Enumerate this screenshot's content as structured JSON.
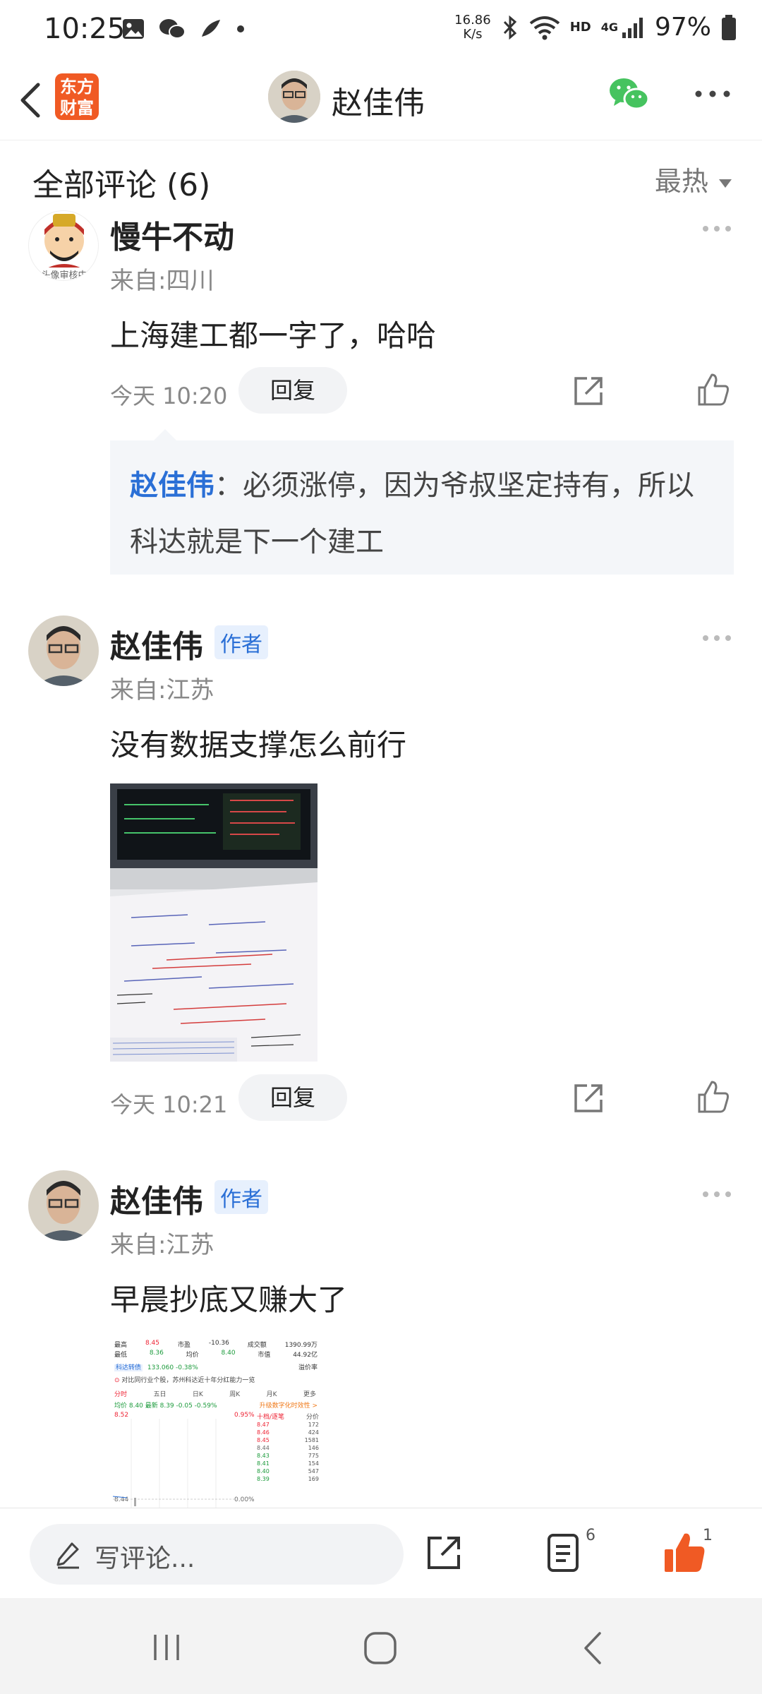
{
  "status_bar": {
    "time": "10:25",
    "speed_value": "16.86",
    "speed_unit": "K/s",
    "network": "4G",
    "hd_label": "HD",
    "battery": "97%"
  },
  "header": {
    "logo_line1": "东方",
    "logo_line2": "财富",
    "title": "赵佳伟"
  },
  "comments_header": {
    "title": "全部评论 (6)",
    "sort_label": "最热"
  },
  "comments": [
    {
      "username": "慢牛不动",
      "avatar_caption": "头像审核中",
      "location": "来自:四川",
      "text": "上海建工都一字了，哈哈",
      "time": "今天 10:20",
      "reply_label": "回复",
      "quoted_reply": {
        "name": "赵佳伟",
        "text": "：必须涨停，因为爷叔坚定持有，所以科达就是下一个建工"
      }
    },
    {
      "username": "赵佳伟",
      "author_tag": "作者",
      "location": "来自:江苏",
      "text": "没有数据支撑怎么前行",
      "time": "今天 10:21",
      "reply_label": "回复"
    },
    {
      "username": "赵佳伟",
      "author_tag": "作者",
      "location": "来自:江苏",
      "text": "早晨抄底又赚大了"
    }
  ],
  "stock_thumb": {
    "row1": [
      "最高",
      "8.45",
      "市盈",
      "-10.36",
      "成交额",
      "1390.99万"
    ],
    "row2": [
      "最低",
      "8.36",
      "均价",
      "8.40",
      "市值",
      "44.92亿"
    ],
    "index_label": "科达转债",
    "index_value": "133.060 -0.38%",
    "premium_label": "溢价率",
    "notice": "对比同行业个股，苏州科达近十年分红能力一览",
    "tabs": [
      "分时",
      "五日",
      "日K",
      "周K",
      "月K",
      "更多"
    ],
    "quote_line": "均价 8.40  最新 8.39  -0.05  -0.59%",
    "hint": "升级数字化时效性 >",
    "price_top": "8.52",
    "pct_top": "0.95%",
    "price_low": "8.44",
    "pct_low": "0.00%",
    "side_header": "十档/逐笔",
    "side_header2": "分价",
    "ticks": [
      [
        "8.47",
        "172"
      ],
      [
        "8.46",
        "424"
      ],
      [
        "8.45",
        "1581"
      ],
      [
        "8.44",
        "146"
      ],
      [
        "8.43",
        "775"
      ],
      [
        "8.41",
        "154"
      ],
      [
        "8.40",
        "547"
      ],
      [
        "8.39",
        "169"
      ]
    ]
  },
  "bottom_bar": {
    "placeholder": "写评论...",
    "comment_count": "6",
    "like_count": "1"
  }
}
